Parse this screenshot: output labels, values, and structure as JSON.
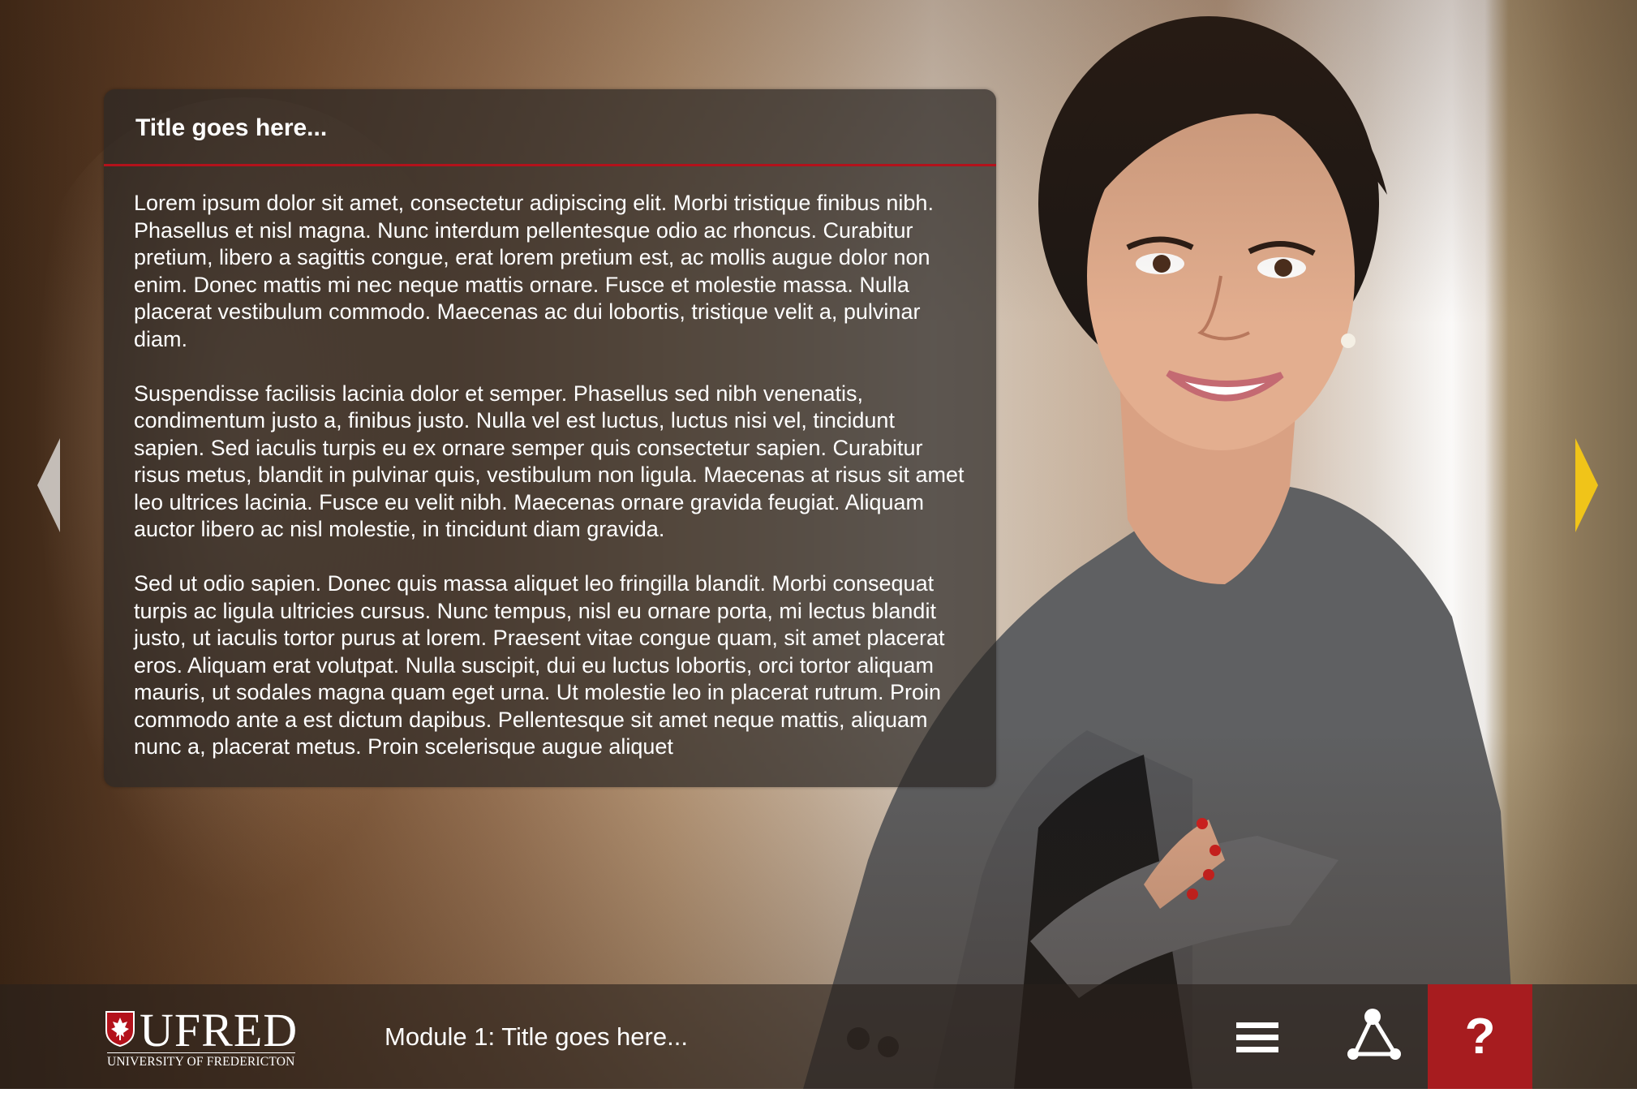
{
  "panel": {
    "title": "Title goes here...",
    "paragraphs": [
      "Lorem ipsum dolor sit amet, consectetur adipiscing elit. Morbi tristique finibus nibh. Phasellus et nisl magna. Nunc interdum pellentesque odio ac rhoncus. Curabitur pretium, libero a sagittis congue, erat lorem pretium est, ac mollis augue dolor non enim. Donec mattis mi nec neque mattis ornare. Fusce et molestie massa. Nulla placerat vestibulum commodo. Maecenas ac dui lobortis, tristique velit a, pulvinar diam.",
      "Suspendisse facilisis lacinia dolor et semper. Phasellus sed nibh venenatis, condimentum justo a, finibus justo. Nulla vel est luctus, luctus nisi vel, tincidunt sapien. Sed iaculis turpis eu ex ornare semper quis consectetur sapien. Curabitur risus metus, blandit in pulvinar quis, vestibulum non ligula. Maecenas at risus sit amet leo ultrices lacinia. Fusce eu velit nibh. Maecenas ornare gravida feugiat. Aliquam auctor libero ac nisl molestie, in tincidunt diam gravida.",
      "Sed ut odio sapien. Donec quis massa aliquet leo fringilla blandit. Morbi consequat turpis ac ligula ultricies cursus. Nunc tempus, nisl eu ornare porta, mi lectus blandit justo, ut iaculis tortor purus at lorem. Praesent vitae congue quam, sit amet placerat eros. Aliquam erat volutpat. Nulla suscipit, dui eu luctus lobortis, orci tortor aliquam mauris, ut sodales magna quam eget urna. Ut molestie leo in placerat rutrum. Proin commodo ante a est dictum dapibus. Pellentesque sit amet neque mattis, aliquam nunc a, placerat metus. Proin scelerisque augue aliquet"
    ]
  },
  "logo": {
    "name": "UFRED",
    "subtitle": "UNIVERSITY OF FREDERICTON"
  },
  "footer": {
    "module_title": "Module 1: Title goes here...",
    "help_label": "?"
  },
  "icons": {
    "prev": "chevron-left-icon",
    "next": "chevron-right-icon",
    "menu": "hamburger-menu-icon",
    "share": "share-network-icon",
    "logo": "maple-leaf-shield-icon"
  },
  "colors": {
    "accent_red": "#a71c1f",
    "title_rule": "#b3121b",
    "next_arrow": "#f0c419",
    "prev_arrow": "#d9d6d2"
  }
}
